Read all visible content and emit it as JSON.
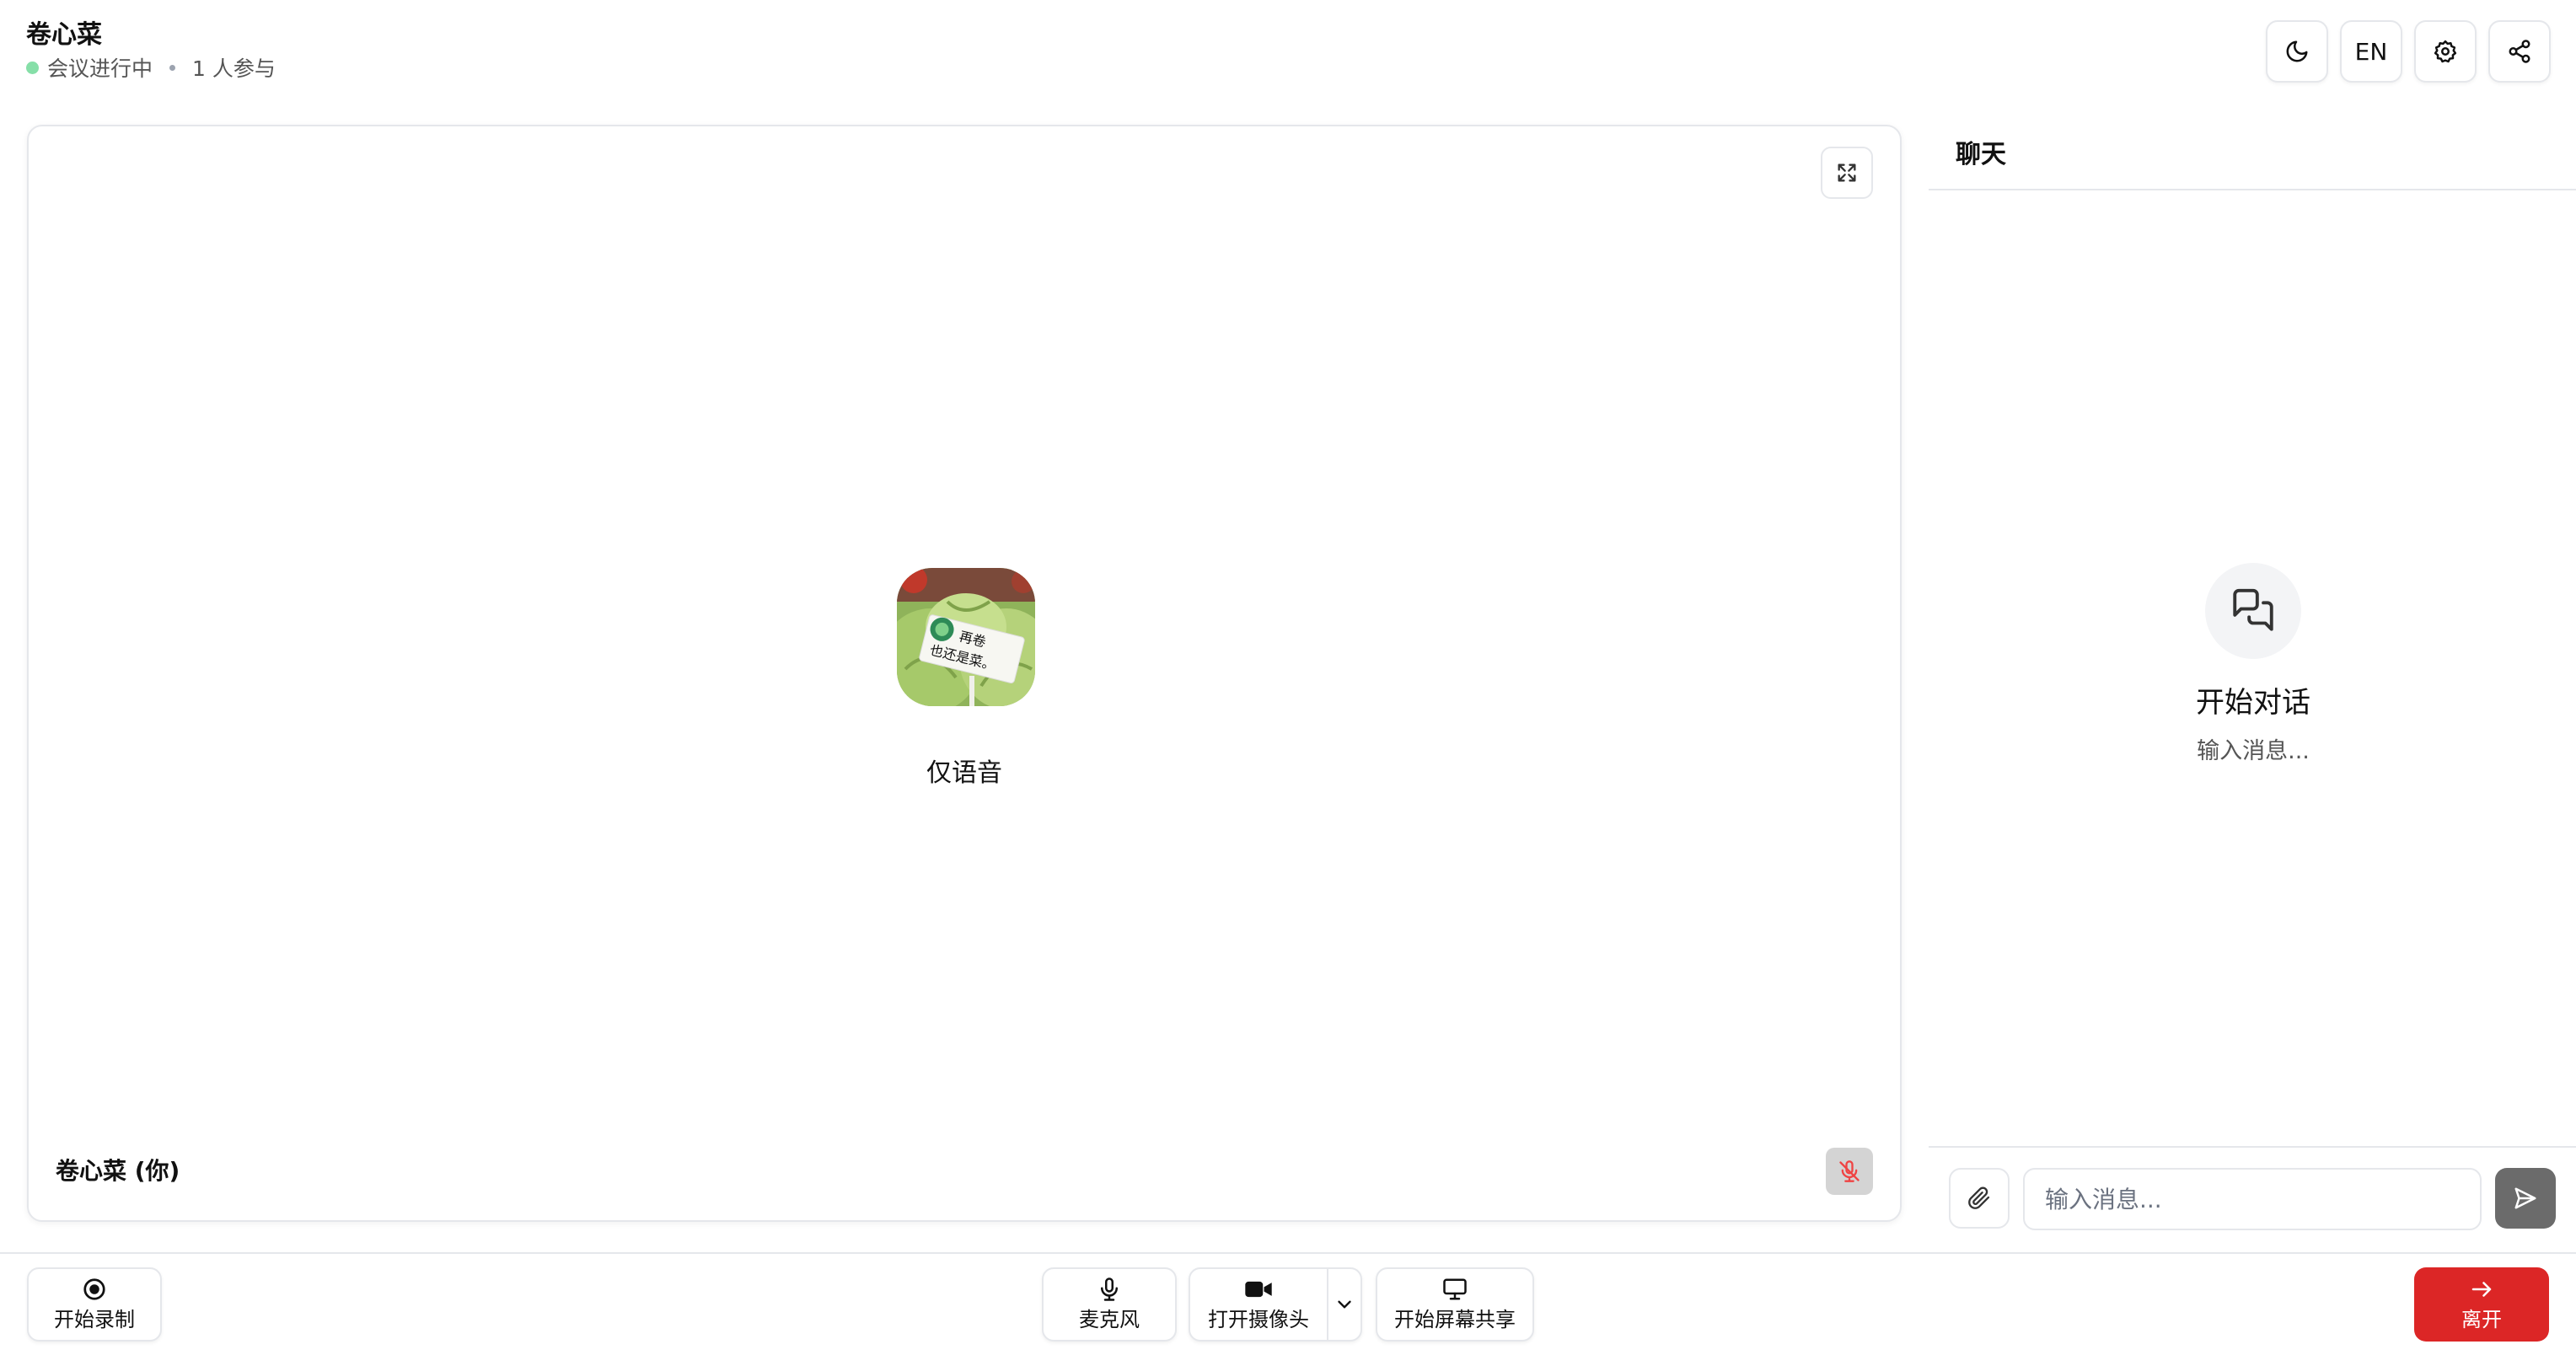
{
  "header": {
    "title": "卷心菜",
    "status_text": "会议进行中",
    "participants_text": "1 人参与",
    "language_label": "EN",
    "status_color": "#86dfa8",
    "icons": {
      "theme": "moon-icon",
      "settings": "settings-icon",
      "share": "share-icon"
    }
  },
  "video": {
    "avatar_alt": "再卷也还是菜。",
    "mode_text": "仅语音",
    "participant_name": "卷心菜 (你)",
    "mic_state_icon": "mic-off-icon",
    "expand_icon": "expand-icon"
  },
  "chat": {
    "title": "聊天",
    "empty_title": "开始对话",
    "empty_subtitle": "输入消息...",
    "input_placeholder": "输入消息...",
    "attach_icon": "paperclip-icon",
    "send_icon": "send-icon"
  },
  "toolbar": {
    "record_label": "开始录制",
    "mic_label": "麦克风",
    "camera_label": "打开摄像头",
    "screen_share_label": "开始屏幕共享",
    "leave_label": "离开",
    "leave_color": "#dc2626"
  }
}
